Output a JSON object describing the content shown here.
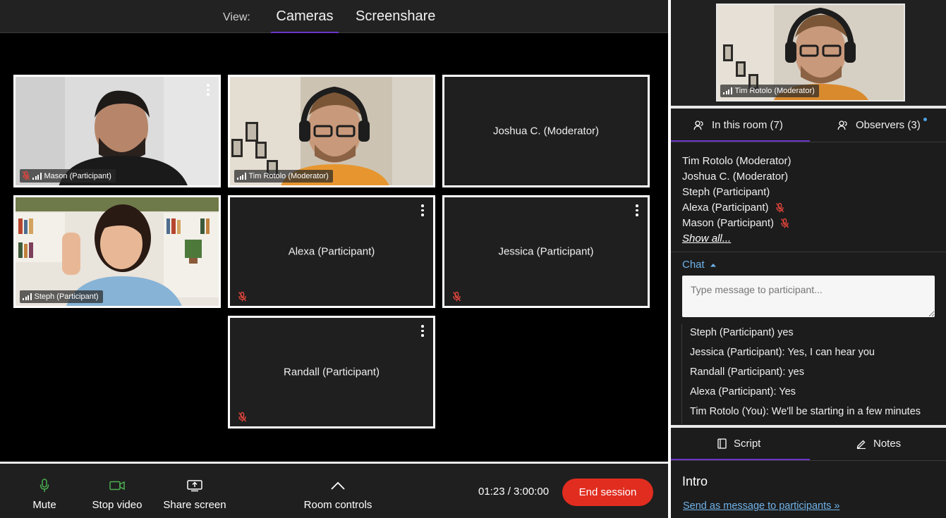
{
  "view_bar": {
    "label": "View:",
    "tabs": [
      {
        "label": "Cameras",
        "active": true
      },
      {
        "label": "Screenshare",
        "active": false
      }
    ],
    "accent": "#6b35c8"
  },
  "tiles": [
    {
      "name": "Mason (Participant)",
      "video": true,
      "muted": true
    },
    {
      "name": "Tim Rotolo (Moderator)",
      "video": true,
      "muted": false
    },
    {
      "name": "Joshua C. (Moderator)",
      "video": false,
      "muted": false
    },
    {
      "name": "Steph (Participant)",
      "video": true,
      "muted": false
    },
    {
      "name": "Alexa (Participant)",
      "video": false,
      "muted": true
    },
    {
      "name": "Jessica (Participant)",
      "video": false,
      "muted": true
    },
    {
      "name": "Randall (Participant)",
      "video": false,
      "muted": true
    }
  ],
  "controls": {
    "mute": "Mute",
    "stop_video": "Stop video",
    "share_screen": "Share screen",
    "room_controls": "Room controls",
    "timer": "01:23 / 3:00:00",
    "end_session": "End session",
    "end_color": "#e12d20",
    "icon_green": "#4caf50"
  },
  "self_view": {
    "label": "Tim Rotolo (Moderator)"
  },
  "room_tabs": {
    "in_room": "In this room (7)",
    "observers": "Observers (3)"
  },
  "participants": [
    {
      "name": "Tim Rotolo (Moderator)",
      "muted": false
    },
    {
      "name": "Joshua C. (Moderator)",
      "muted": false
    },
    {
      "name": "Steph (Participant)",
      "muted": false
    },
    {
      "name": "Alexa (Participant)",
      "muted": true
    },
    {
      "name": "Mason (Participant)",
      "muted": true
    }
  ],
  "show_all": "Show all...",
  "chat": {
    "header": "Chat",
    "placeholder": "Type message to participant...",
    "messages": [
      "Steph (Participant) yes",
      "Jessica (Participant): Yes, I can hear you",
      "Randall (Participant): yes",
      "Alexa (Participant): Yes",
      "Tim Rotolo (You): We'll be starting in a few minutes"
    ]
  },
  "bottom_tabs": {
    "script": "Script",
    "notes": "Notes"
  },
  "script_panel": {
    "section_title": "Intro",
    "send_link": "Send as message to participants »"
  }
}
